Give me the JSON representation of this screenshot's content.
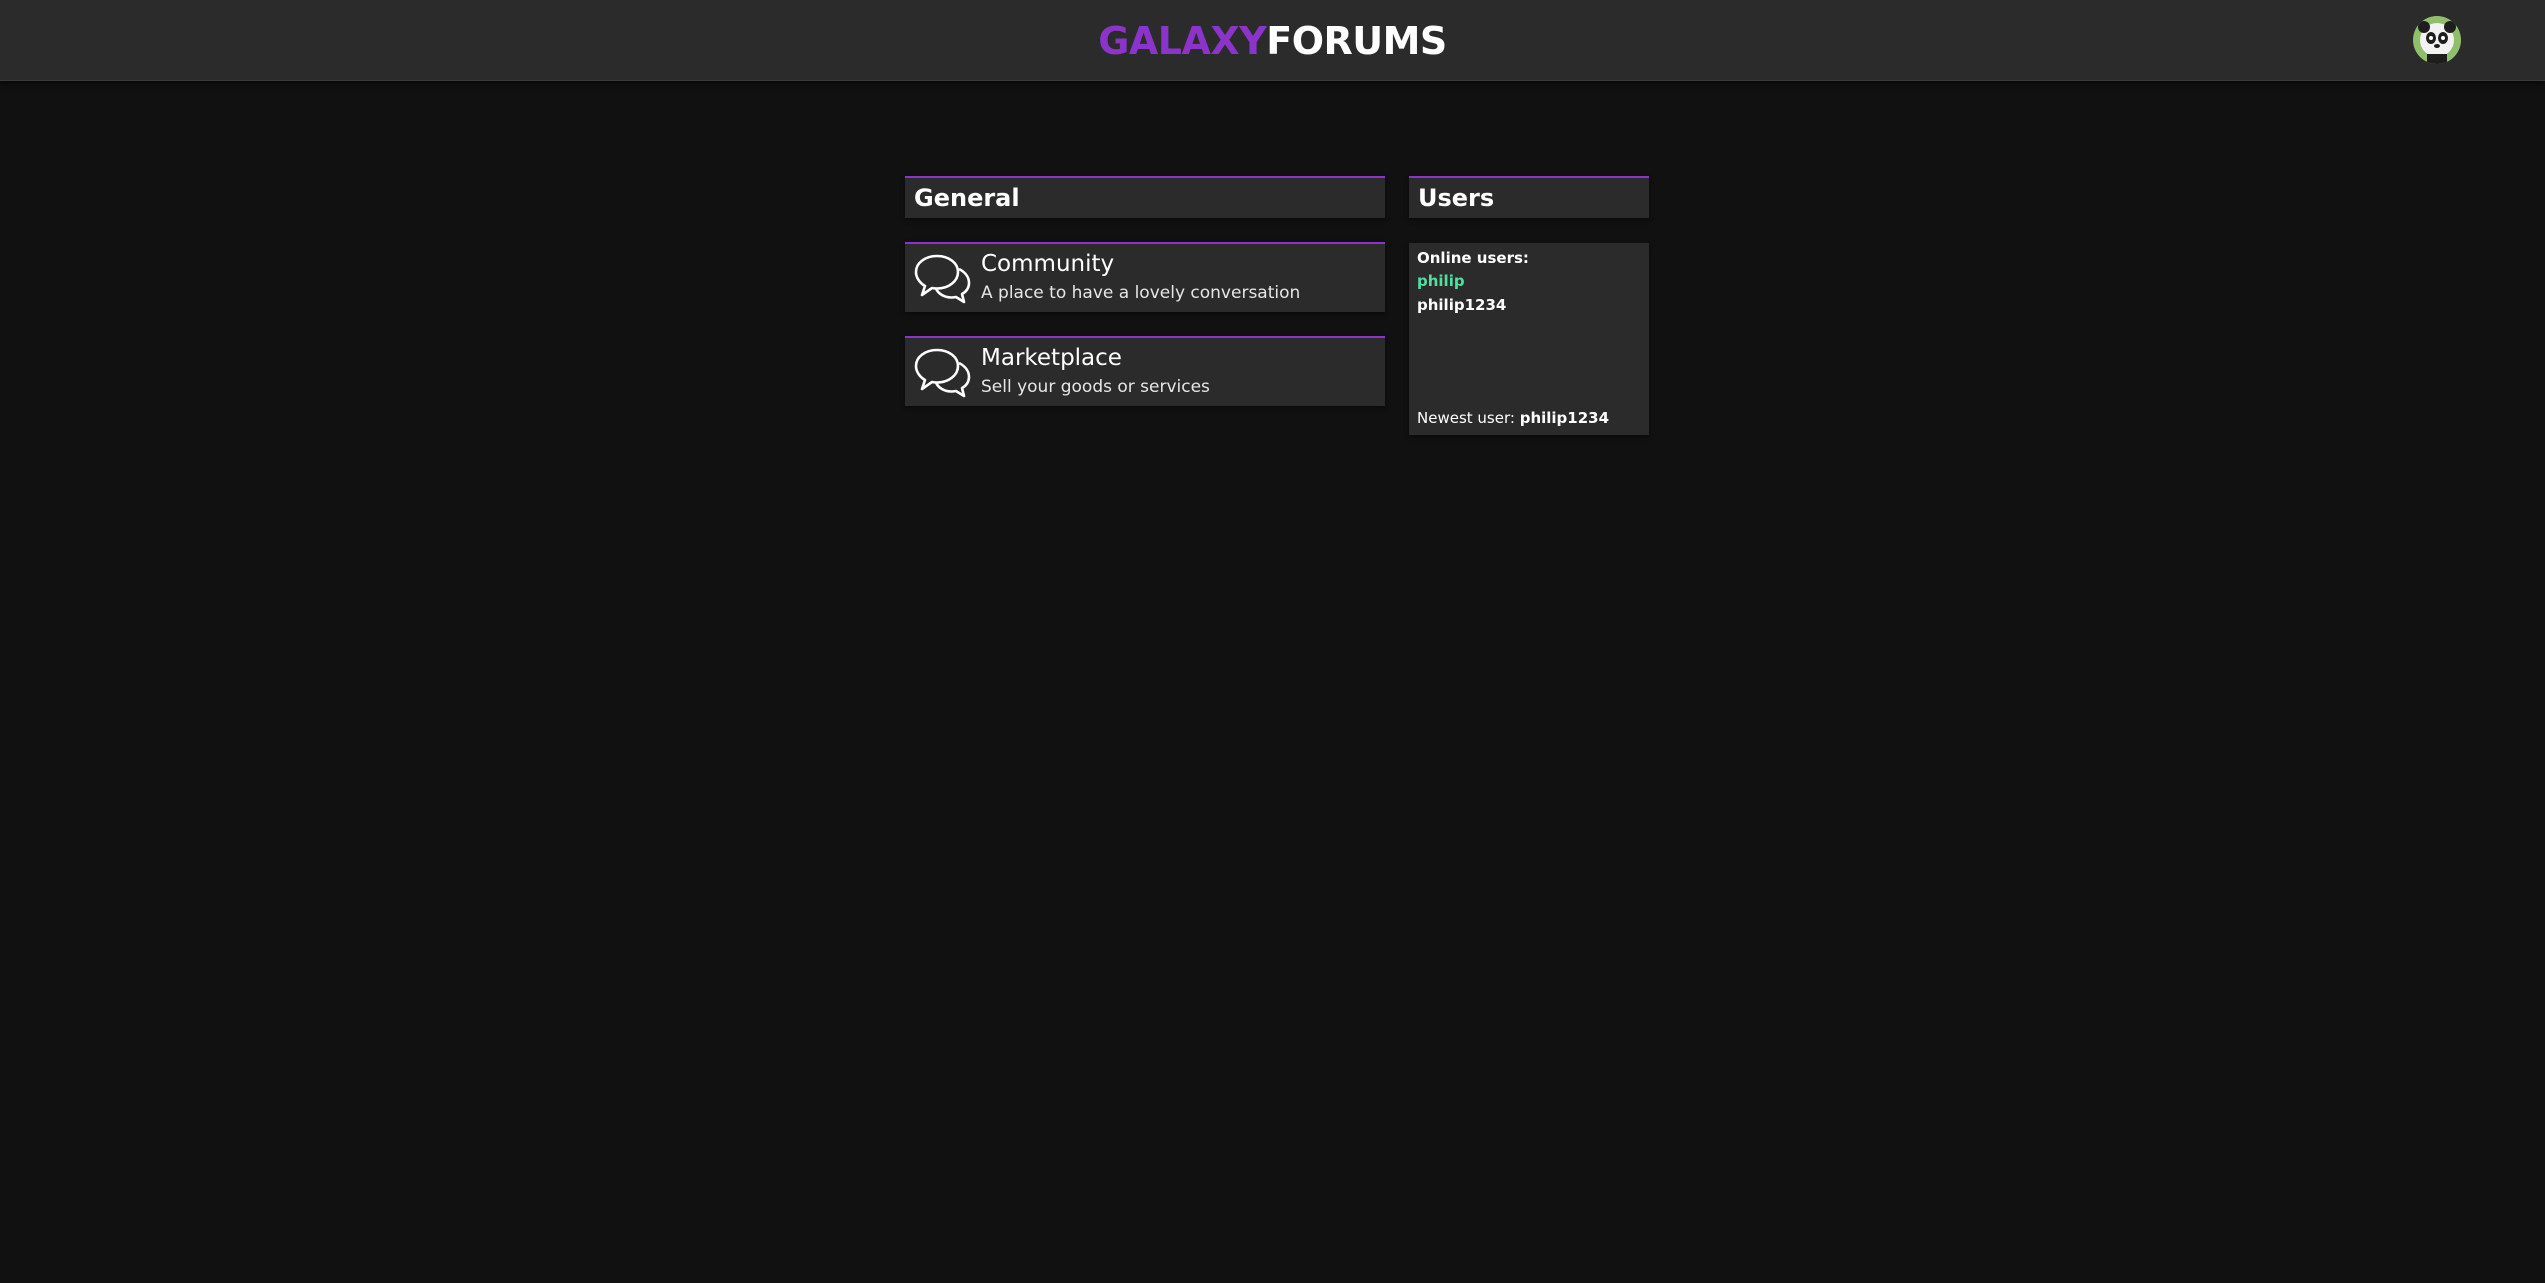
{
  "header": {
    "logo_part1": "GALAXY",
    "logo_part2": "FORUMS",
    "avatar_icon": "panda-avatar-icon"
  },
  "colors": {
    "accent": "#8a34c9",
    "online_user": "#4fe0a0",
    "panel_bg": "#2b2b2b",
    "page_bg": "#111111"
  },
  "general": {
    "title": "General",
    "forums": [
      {
        "title": "Community",
        "description": "A place to have a lovely conversation",
        "icon": "chat-bubbles-icon"
      },
      {
        "title": "Marketplace",
        "description": "Sell your goods or services",
        "icon": "chat-bubbles-icon"
      }
    ]
  },
  "users": {
    "title": "Users",
    "online_label": "Online users:",
    "online": [
      "philip",
      "philip1234"
    ],
    "newest_label": "Newest user:",
    "newest_user": "philip1234"
  }
}
